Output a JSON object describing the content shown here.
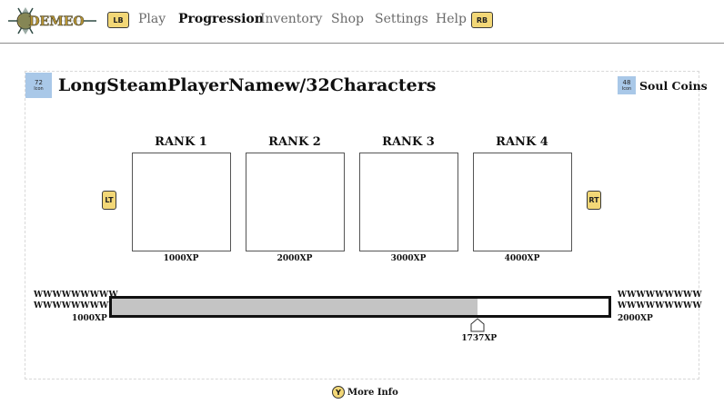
{
  "nav": {
    "logo_text": "DEMEO",
    "lb": "LB",
    "rb": "RB",
    "items": [
      "Play",
      "Progression",
      "Inventory",
      "Shop",
      "Settings",
      "Help"
    ],
    "active": "Progression"
  },
  "profile": {
    "icon_number": "72",
    "icon_caption": "Icon",
    "player_name": "LongSteamPlayerNamew/32Characters"
  },
  "currency": {
    "icon_number": "48",
    "icon_caption": "Icon",
    "label": "Soul Coins"
  },
  "ranks": [
    {
      "title": "RANK 1",
      "xp": "1000XP"
    },
    {
      "title": "RANK 2",
      "xp": "2000XP"
    },
    {
      "title": "RANK 3",
      "xp": "3000XP"
    },
    {
      "title": "RANK 4",
      "xp": "4000XP"
    }
  ],
  "shoulder": {
    "lt": "LT",
    "rt": "RT"
  },
  "xp_bar": {
    "left_line1": "WWWWWWWWW",
    "left_line2": "WWWWWWWWW",
    "left_xp": "1000XP",
    "right_line1": "WWWWWWWWW",
    "right_line2": "WWWWWWWWW",
    "right_xp": "2000XP",
    "current_xp": "1737XP",
    "progress": 0.737
  },
  "footer": {
    "y_button": "Y",
    "more_info": "More Info"
  },
  "colors": {
    "button_gold": "#f2d777",
    "icon_blue": "#a9c8e8",
    "bar_fill": "#c4c4c4"
  }
}
